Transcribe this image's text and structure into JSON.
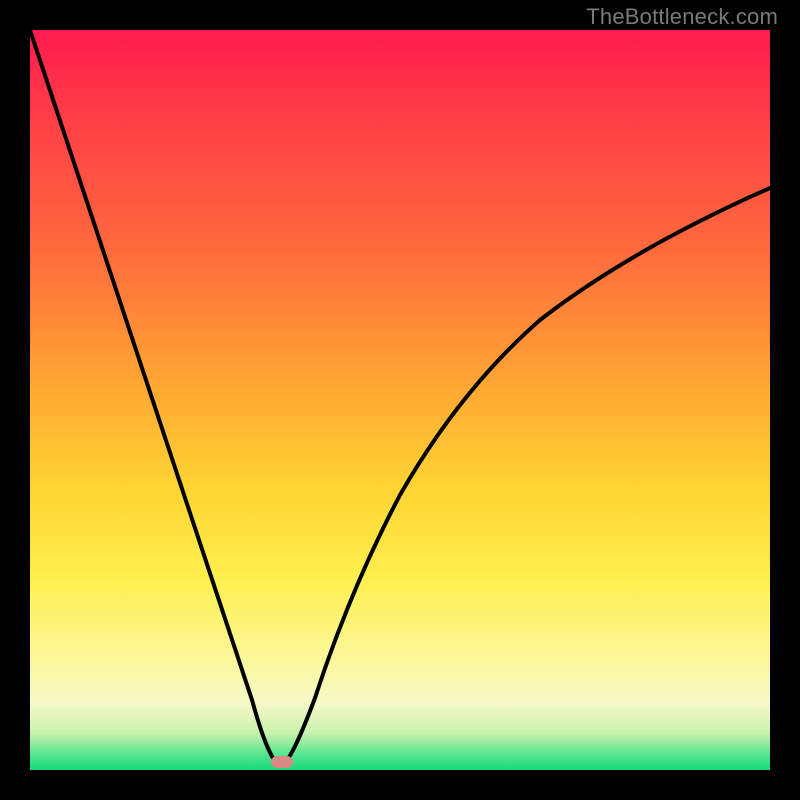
{
  "watermark": "TheBottleneck.com",
  "chart_data": {
    "type": "line",
    "title": "",
    "xlabel": "",
    "ylabel": "",
    "xlim": [
      0,
      100
    ],
    "ylim": [
      0,
      100
    ],
    "x": [
      0,
      5,
      10,
      15,
      20,
      25,
      30,
      33,
      34,
      35,
      40,
      45,
      50,
      55,
      60,
      65,
      70,
      75,
      80,
      85,
      90,
      95,
      100
    ],
    "y": [
      100,
      85,
      70,
      55,
      41,
      27,
      12,
      2,
      0,
      3,
      18,
      32,
      43,
      52,
      59,
      64,
      68,
      71,
      73,
      75,
      77,
      78,
      79
    ],
    "minimum": {
      "x": 34,
      "y": 0
    },
    "gradient_scale": {
      "top_color": "#ff1a4e",
      "bottom_color": "#18d87a",
      "meaning": "bottleneck severity (high at top, low at bottom)"
    }
  },
  "marker": {
    "semantic": "optimal-point"
  }
}
